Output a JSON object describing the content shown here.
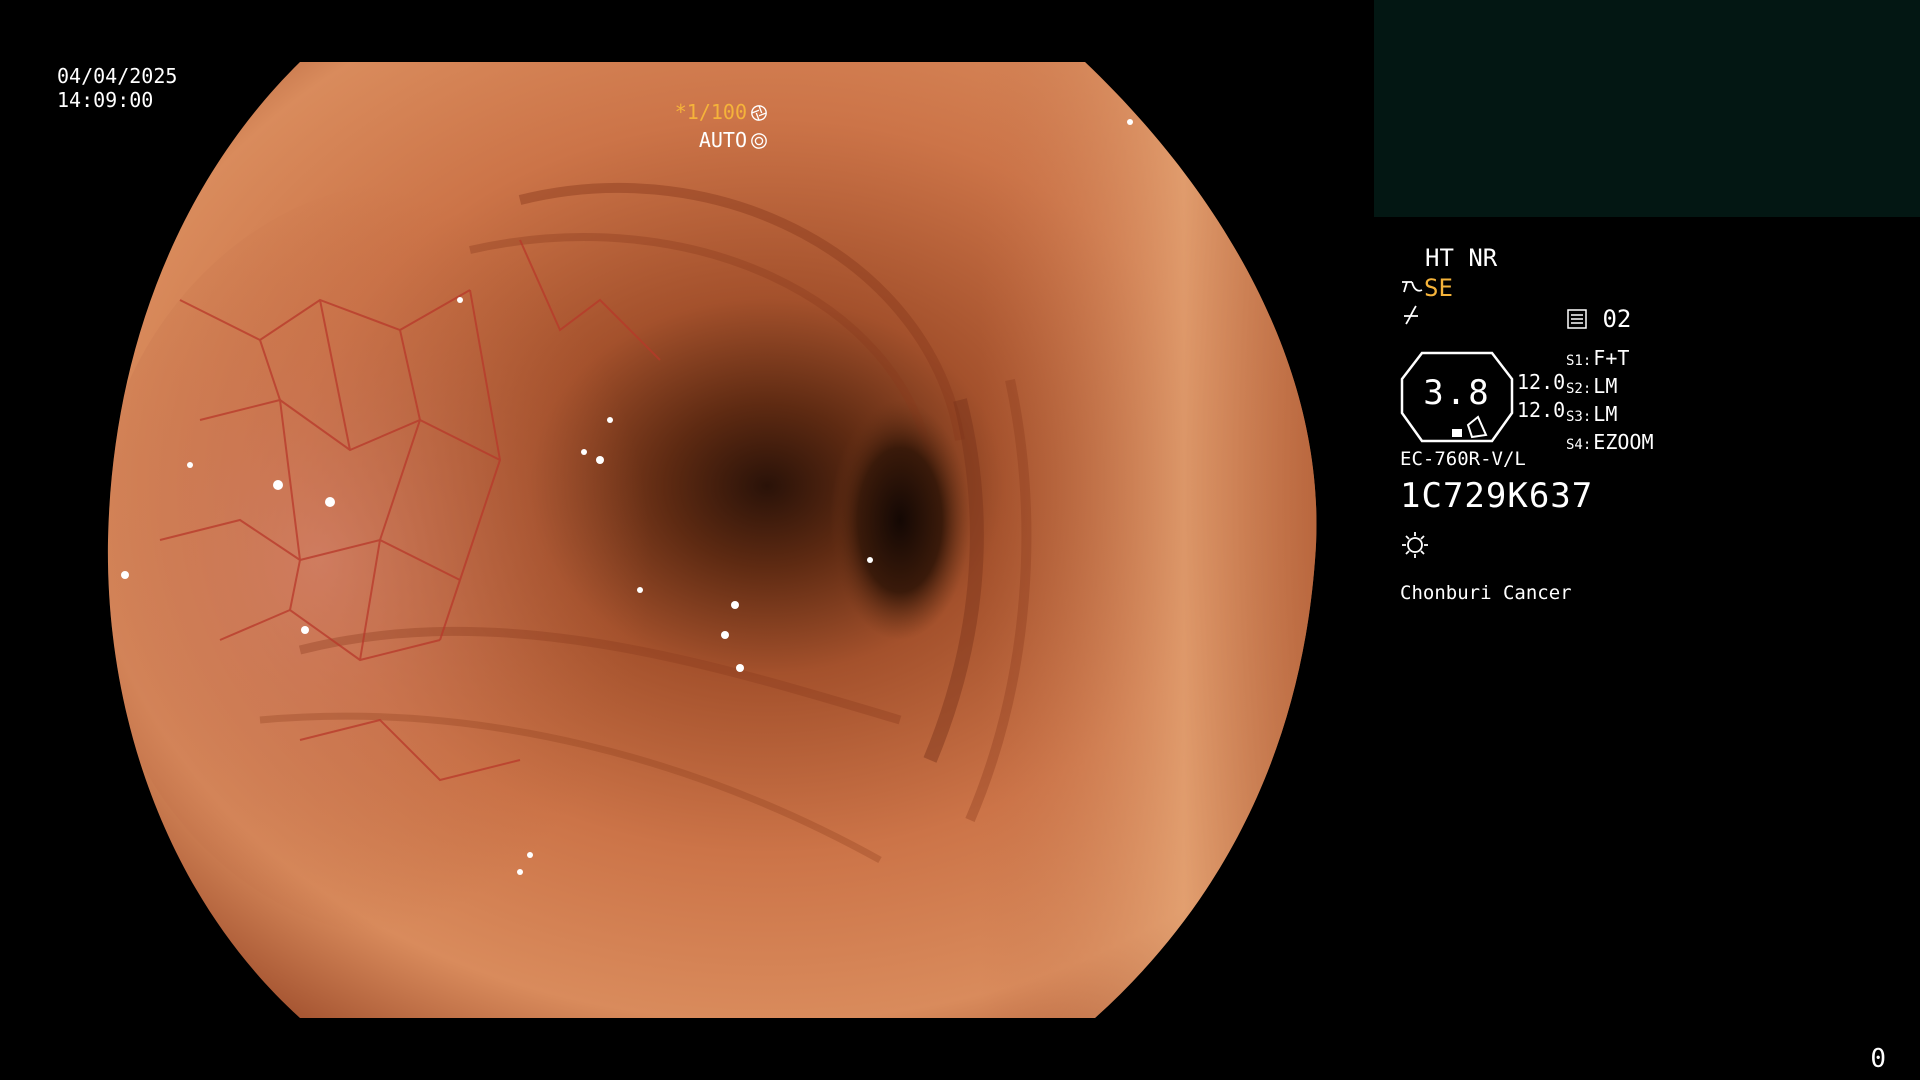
{
  "overlay": {
    "date": "04/04/2025",
    "time": "14:09:00",
    "shutter": "*1/100",
    "iris": "AUTO",
    "counter": "0"
  },
  "panel": {
    "mode": "HT NR",
    "enhance": "SE",
    "preset": "02",
    "gauge_value": "3.8",
    "gauge_side": [
      "12.0",
      "12.0"
    ],
    "switches": [
      {
        "key": "S1:",
        "value": "F+T"
      },
      {
        "key": "S2:",
        "value": "LM"
      },
      {
        "key": "S3:",
        "value": "LM"
      },
      {
        "key": "S4:",
        "value": "EZOOM"
      }
    ],
    "scope_model": "EC-760R-V/L",
    "scope_serial": "1C729K637",
    "hospital": "Chonburi Cancer"
  },
  "icons": {
    "shutter": "aperture-icon",
    "iris": "iris-icon",
    "enhance": "structure-enhance-icon",
    "structure": "structure-icon",
    "preset": "memory-card-icon",
    "light": "light-source-icon"
  },
  "colors": {
    "accent": "#f5b33a",
    "background": "#000000",
    "pip": "#031713"
  }
}
